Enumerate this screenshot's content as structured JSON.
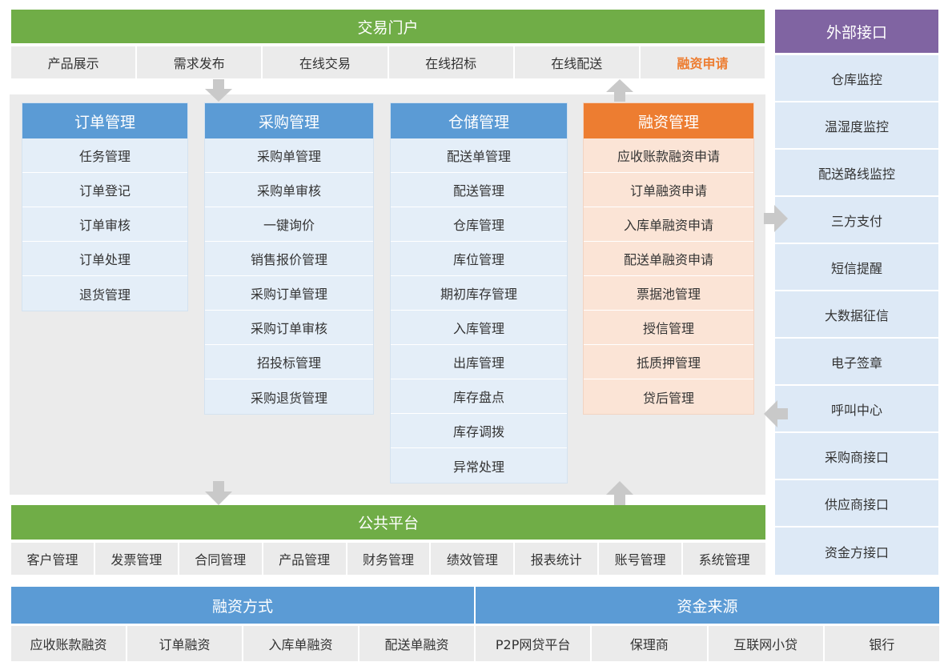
{
  "portal": {
    "title": "交易门户",
    "items": [
      "产品展示",
      "需求发布",
      "在线交易",
      "在线招标",
      "在线配送",
      "融资申请"
    ]
  },
  "external": {
    "title": "外部接口",
    "items": [
      "仓库监控",
      "温湿度监控",
      "配送路线监控",
      "三方支付",
      "短信提醒",
      "大数据征信",
      "电子签章",
      "呼叫中心",
      "采购商接口",
      "供应商接口",
      "资金方接口"
    ]
  },
  "modules": {
    "order": {
      "title": "订单管理",
      "items": [
        "任务管理",
        "订单登记",
        "订单审核",
        "订单处理",
        "退货管理"
      ]
    },
    "purchase": {
      "title": "采购管理",
      "items": [
        "采购单管理",
        "采购单审核",
        "一键询价",
        "销售报价管理",
        "采购订单管理",
        "采购订单审核",
        "招投标管理",
        "采购退货管理"
      ]
    },
    "storage": {
      "title": "仓储管理",
      "items": [
        "配送单管理",
        "配送管理",
        "仓库管理",
        "库位管理",
        "期初库存管理",
        "入库管理",
        "出库管理",
        "库存盘点",
        "库存调拨",
        "异常处理"
      ]
    },
    "finance": {
      "title": "融资管理",
      "items": [
        "应收账款融资申请",
        "订单融资申请",
        "入库单融资申请",
        "配送单融资申请",
        "票据池管理",
        "授信管理",
        "抵质押管理",
        "贷后管理"
      ]
    }
  },
  "public_platform": {
    "title": "公共平台",
    "items": [
      "客户管理",
      "发票管理",
      "合同管理",
      "产品管理",
      "财务管理",
      "绩效管理",
      "报表统计",
      "账号管理",
      "系统管理"
    ]
  },
  "financing_methods": {
    "title": "融资方式",
    "items": [
      "应收账款融资",
      "订单融资",
      "入库单融资",
      "配送单融资"
    ]
  },
  "fund_sources": {
    "title": "资金来源",
    "items": [
      "P2P网贷平台",
      "保理商",
      "互联网小贷",
      "银行"
    ]
  },
  "colors": {
    "green": "#70ad47",
    "purple": "#8064a2",
    "blue": "#5b9bd5",
    "orange": "#ed7d31",
    "gray": "#ebebeb",
    "light_blue": "#dde9f6",
    "peach": "#fbe4d6"
  }
}
